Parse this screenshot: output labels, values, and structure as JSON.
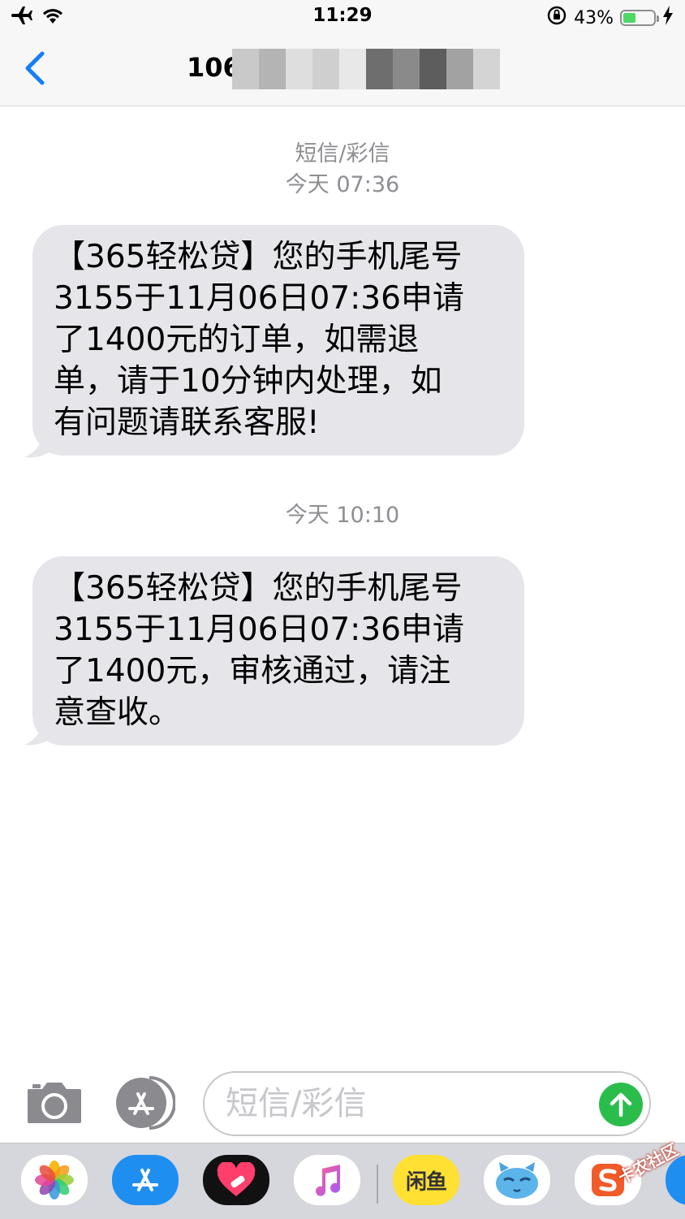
{
  "status_bar": {
    "time": "11:29",
    "battery_percent": "43%",
    "battery_level": 0.43,
    "icons": [
      "airplane-icon",
      "wifi-icon",
      "orientation-lock-icon",
      "battery-icon",
      "charging-icon"
    ]
  },
  "nav": {
    "contact_visible": "106",
    "back_icon": "chevron-left-icon"
  },
  "conversation": {
    "channel_label": "短信/彩信",
    "groups": [
      {
        "timestamp": "今天 07:36",
        "message": "【365轻松贷】您的手机尾号\n3155于11月06日07:36申请\n了1400元的订单，如需退\n单，请于10分钟内处理，如\n有问题请联系客服!"
      },
      {
        "timestamp": "今天 10:10",
        "message": "【365轻松贷】您的手机尾号\n3155于11月06日07:36申请\n了1400元，审核通过，请注\n意查收。"
      }
    ]
  },
  "input": {
    "placeholder": "短信/彩信",
    "camera_icon": "camera-icon",
    "appstore_icon": "app-store-icon",
    "send_icon": "arrow-up-icon"
  },
  "app_drawer": {
    "xianyu_label": "闲鱼",
    "apps": [
      "photos-icon",
      "app-store-icon",
      "heart-sticker-icon",
      "music-icon",
      "xianyu-icon",
      "cat-face-icon",
      "sogou-icon"
    ]
  },
  "watermark": "卡农社区",
  "colors": {
    "accent_blue": "#147efb",
    "bubble_gray": "#e5e5ea",
    "send_green": "#2bbd4c",
    "timestamp_gray": "#8e8e93"
  }
}
